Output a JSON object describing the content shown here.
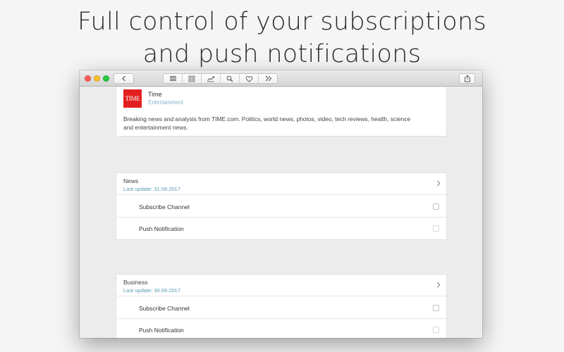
{
  "headline": {
    "line1": "Full control of your subscriptions",
    "line2": "and push notifications"
  },
  "toolbar": {
    "back_icon": "chevron-left-icon",
    "segments": [
      "list-icon",
      "grid-icon",
      "trending-icon",
      "search-icon",
      "heart-icon",
      "double-chevron-icon"
    ],
    "share_icon": "share-icon"
  },
  "publication": {
    "logo_text": "TIME",
    "name": "Time",
    "category": "Entertainment",
    "description": "Breaking news and analysis from TIME.com. Politics, world news, photos, video, tech reviews, health, science and entertainment news."
  },
  "sections": [
    {
      "title": "News",
      "last_update": "Last update: 31.08.2017",
      "subscribe_label": "Subscribe Channel",
      "push_label": "Push Notification"
    },
    {
      "title": "Business",
      "last_update": "Last update: 30.08.2017",
      "subscribe_label": "Subscribe Channel",
      "push_label": "Push Notification"
    }
  ],
  "colors": {
    "accent": "#5b9ab0",
    "logo_red": "#e21f1f"
  }
}
